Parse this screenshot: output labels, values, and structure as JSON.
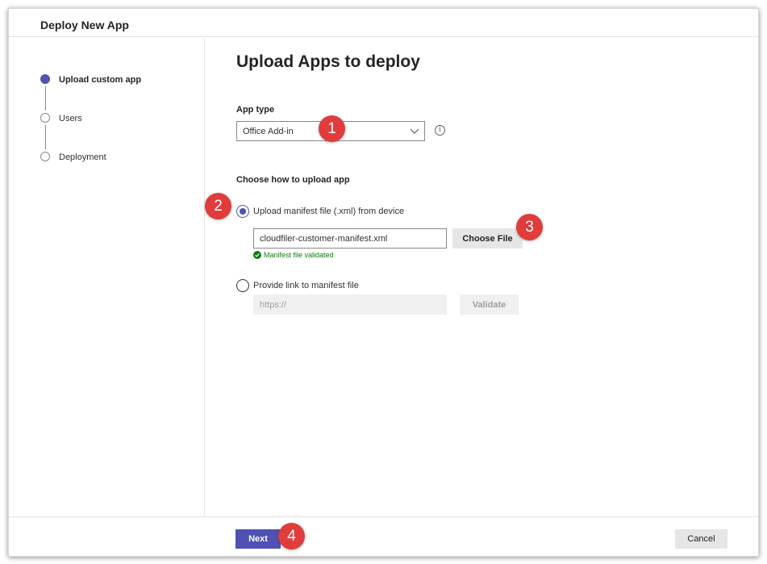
{
  "window": {
    "title": "Deploy New App"
  },
  "steps": [
    {
      "label": "Upload custom app",
      "active": true
    },
    {
      "label": "Users",
      "active": false
    },
    {
      "label": "Deployment",
      "active": false
    }
  ],
  "main": {
    "title": "Upload Apps to deploy",
    "app_type": {
      "label": "App type",
      "value": "Office Add-in",
      "info_icon": "info-icon"
    },
    "upload": {
      "label": "Choose how to upload app",
      "option_device": {
        "label": "Upload manifest file (.xml) from device",
        "checked": true
      },
      "file_value": "cloudfiler-customer-manifest.xml",
      "choose_file_label": "Choose File",
      "validated_text": "Manifest file validated",
      "option_link": {
        "label": "Provide link to manifest file",
        "checked": false
      },
      "link_placeholder": "https://",
      "validate_label": "Validate"
    }
  },
  "footer": {
    "next_label": "Next",
    "cancel_label": "Cancel"
  },
  "annotations": [
    "1",
    "2",
    "3",
    "4"
  ],
  "colors": {
    "accent": "#4f52b2",
    "success": "#107c10",
    "badge": "#e03c3c"
  }
}
